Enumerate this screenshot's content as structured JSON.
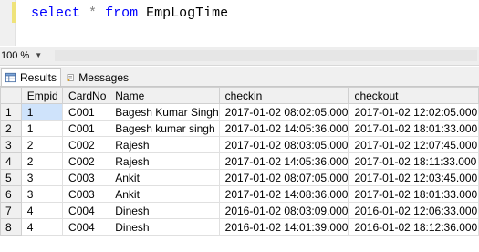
{
  "editor": {
    "query_keyword1": "select",
    "query_star": "*",
    "query_keyword2": "from",
    "query_table": "EmpLogTime"
  },
  "zoom": {
    "value": "100 %"
  },
  "tabs": {
    "results_label": "Results",
    "messages_label": "Messages"
  },
  "grid": {
    "columns": [
      "Empid",
      "CardNo",
      "Name",
      "checkin",
      "checkout"
    ],
    "rows": [
      {
        "rownum": "1",
        "cells": [
          "1",
          "C001",
          "Bagesh Kumar Singh",
          "2017-01-02 08:02:05.000",
          "2017-01-02 12:02:05.000"
        ]
      },
      {
        "rownum": "2",
        "cells": [
          "1",
          "C001",
          "Bagesh kumar singh",
          "2017-01-02 14:05:36.000",
          "2017-01-02 18:01:33.000"
        ]
      },
      {
        "rownum": "3",
        "cells": [
          "2",
          "C002",
          "Rajesh",
          "2017-01-02 08:03:05.000",
          "2017-01-02 12:07:45.000"
        ]
      },
      {
        "rownum": "4",
        "cells": [
          "2",
          "C002",
          "Rajesh",
          "2017-01-02 14:05:36.000",
          "2017-01-02 18:11:33.000"
        ]
      },
      {
        "rownum": "5",
        "cells": [
          "3",
          "C003",
          "Ankit",
          "2017-01-02 08:07:05.000",
          "2017-01-02 12:03:45.000"
        ]
      },
      {
        "rownum": "6",
        "cells": [
          "3",
          "C003",
          "Ankit",
          "2017-01-02 14:08:36.000",
          "2017-01-02 18:01:33.000"
        ]
      },
      {
        "rownum": "7",
        "cells": [
          "4",
          "C004",
          "Dinesh",
          "2016-01-02 08:03:09.000",
          "2016-01-02 12:06:33.000"
        ]
      },
      {
        "rownum": "8",
        "cells": [
          "4",
          "C004",
          "Dinesh",
          "2016-01-02 14:01:39.000",
          "2016-01-02 18:12:36.000"
        ]
      }
    ]
  },
  "colors": {
    "keyword": "#0000ff",
    "selected_cell": "#cfe3fb"
  }
}
